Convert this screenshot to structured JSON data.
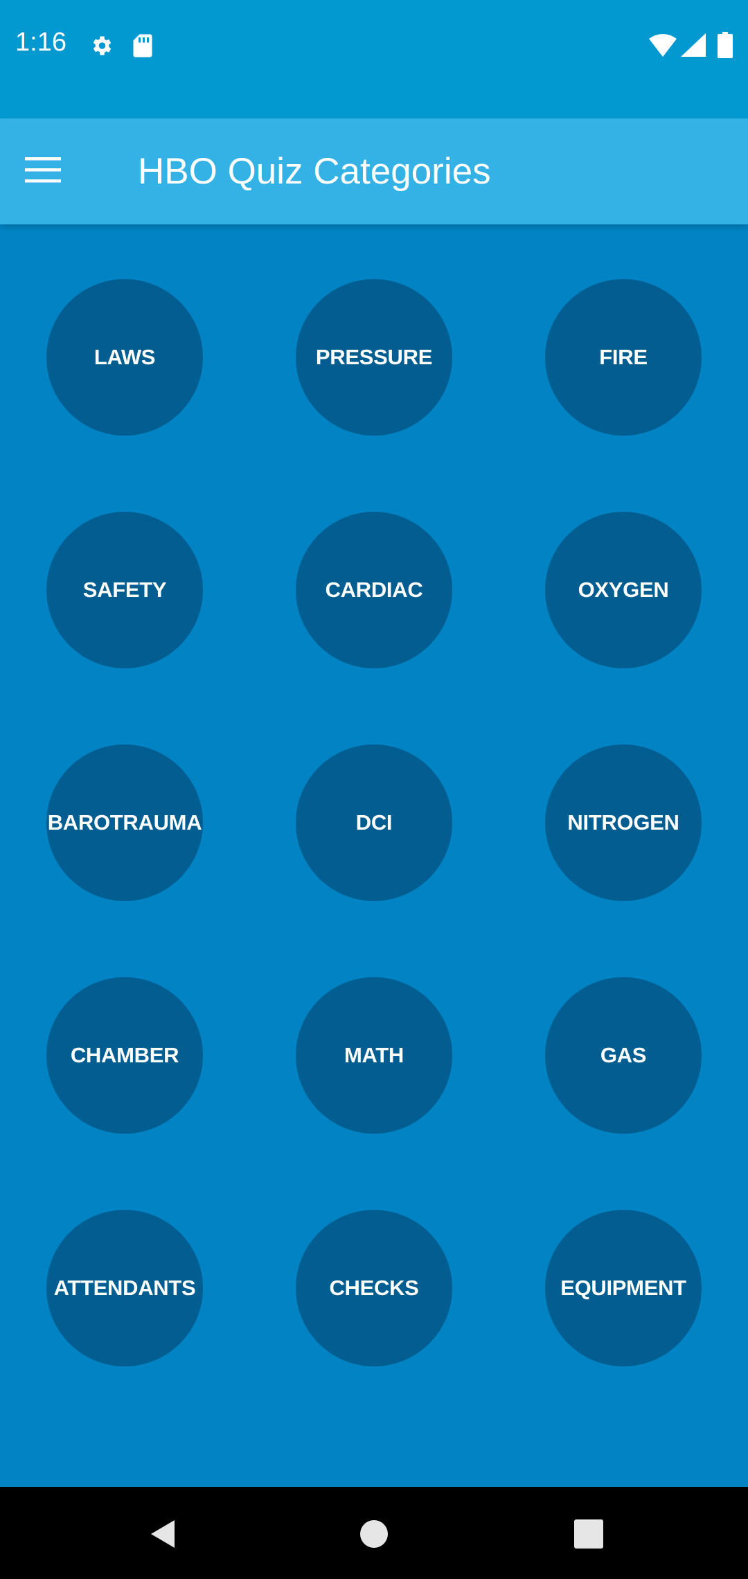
{
  "status_bar": {
    "time": "1:16",
    "icons": [
      "gear-icon",
      "sd-card-icon",
      "wifi-icon",
      "signal-icon",
      "battery-icon"
    ]
  },
  "app_bar": {
    "menu_icon": "hamburger-menu-icon",
    "title": "HBO Quiz Categories"
  },
  "categories": [
    {
      "label": "LAWS"
    },
    {
      "label": "PRESSURE"
    },
    {
      "label": "FIRE"
    },
    {
      "label": "SAFETY"
    },
    {
      "label": "CARDIAC"
    },
    {
      "label": "OXYGEN"
    },
    {
      "label": "BAROTRAUMA"
    },
    {
      "label": "DCI"
    },
    {
      "label": "NITROGEN"
    },
    {
      "label": "CHAMBER"
    },
    {
      "label": "MATH"
    },
    {
      "label": "GAS"
    },
    {
      "label": "ATTENDANTS"
    },
    {
      "label": "CHECKS"
    },
    {
      "label": "EQUIPMENT"
    }
  ],
  "nav_bar": {
    "icons": [
      "back-icon",
      "home-icon",
      "recents-icon"
    ]
  },
  "colors": {
    "status_bar": "#0299d0",
    "app_bar": "#34b2e6",
    "background": "#0284c4",
    "circle": "#025e91",
    "text": "#ffffff",
    "nav_bar": "#000000"
  }
}
